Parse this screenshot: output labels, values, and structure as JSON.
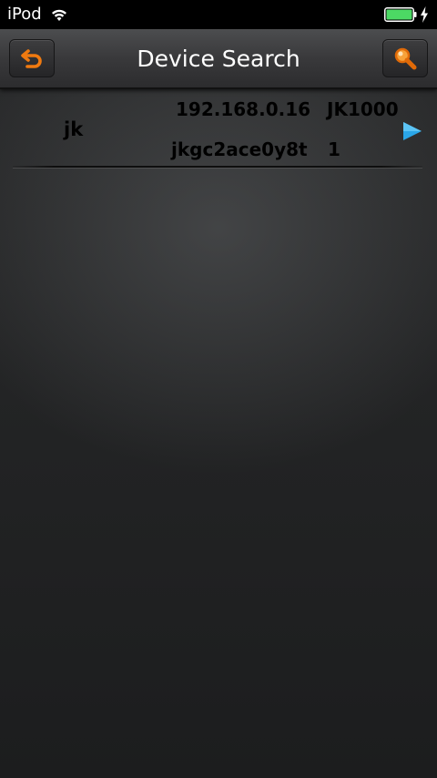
{
  "status_bar": {
    "carrier": "iPod"
  },
  "nav": {
    "title": "Device Search",
    "back_icon": "back-arrow-icon",
    "search_icon": "magnifier-icon",
    "accent_color": "#f07a10"
  },
  "devices": [
    {
      "name": "jk",
      "ip": "192.168.0.16",
      "model": "JK1000",
      "id": "jkgc2ace0y8t",
      "channel": "1"
    }
  ],
  "colors": {
    "arrow": "#2aa6e8",
    "battery": "#4cd964"
  }
}
